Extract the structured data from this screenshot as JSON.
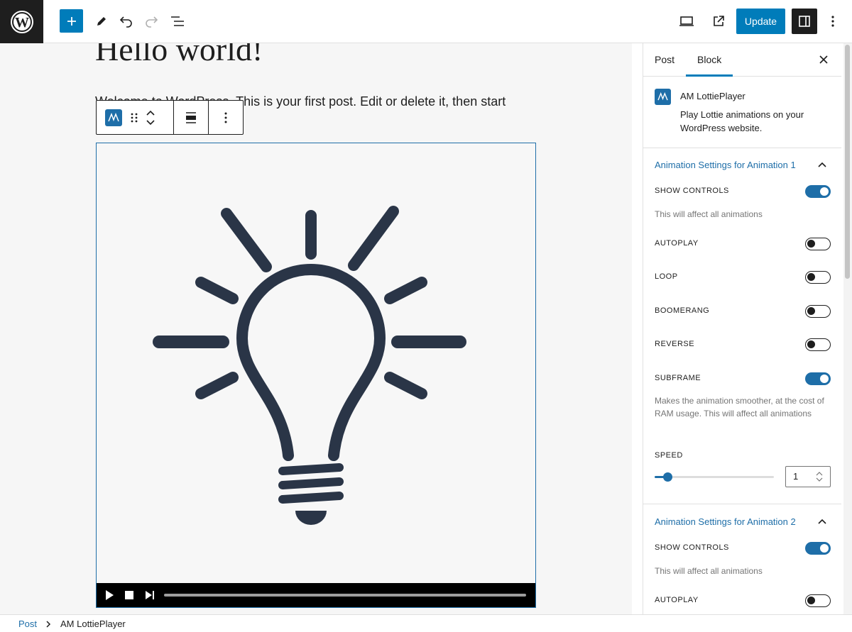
{
  "header": {
    "update_label": "Update"
  },
  "editor": {
    "title": "Hello world!",
    "paragraph": "Welcome to WordPress. This is your first post. Edit or delete it, then start"
  },
  "sidebar": {
    "tabs": [
      {
        "label": "Post",
        "active": false
      },
      {
        "label": "Block",
        "active": true
      }
    ],
    "block": {
      "name": "AM LottiePlayer",
      "description": "Play Lottie animations on your WordPress website."
    },
    "panels": [
      {
        "title": "Animation Settings for Animation 1",
        "settings": [
          {
            "label": "SHOW CONTROLS",
            "on": true,
            "help": "This will affect all animations"
          },
          {
            "label": "AUTOPLAY",
            "on": false
          },
          {
            "label": "LOOP",
            "on": false
          },
          {
            "label": "BOOMERANG",
            "on": false
          },
          {
            "label": "REVERSE",
            "on": false
          },
          {
            "label": "SUBFRAME",
            "on": true,
            "help": "Makes the animation smoother, at the cost of RAM usage. This will affect all animations"
          }
        ],
        "speed": {
          "label": "SPEED",
          "value": "1",
          "slider_fraction": 0.11
        }
      },
      {
        "title": "Animation Settings for Animation 2",
        "settings": [
          {
            "label": "SHOW CONTROLS",
            "on": true,
            "help": "This will affect all animations"
          },
          {
            "label": "AUTOPLAY",
            "on": false
          }
        ]
      }
    ]
  },
  "footer": {
    "breadcrumb": [
      "Post",
      "AM LottiePlayer"
    ]
  },
  "colors": {
    "accent": "#007cba",
    "plugin_blue": "#1e6ea8",
    "dark": "#1e1e1e",
    "bulb": "#2a3547"
  }
}
